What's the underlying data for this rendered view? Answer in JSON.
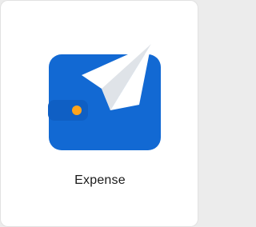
{
  "app": {
    "name": "Expense",
    "icon": "wallet-with-paper-plane-icon"
  },
  "colors": {
    "wallet_blue": "#1269d3",
    "wallet_orange": "#ffa31a",
    "clasp_blue": "#0f5fc4",
    "plane_white": "#ffffff",
    "plane_shade": "#dfe3e8"
  }
}
